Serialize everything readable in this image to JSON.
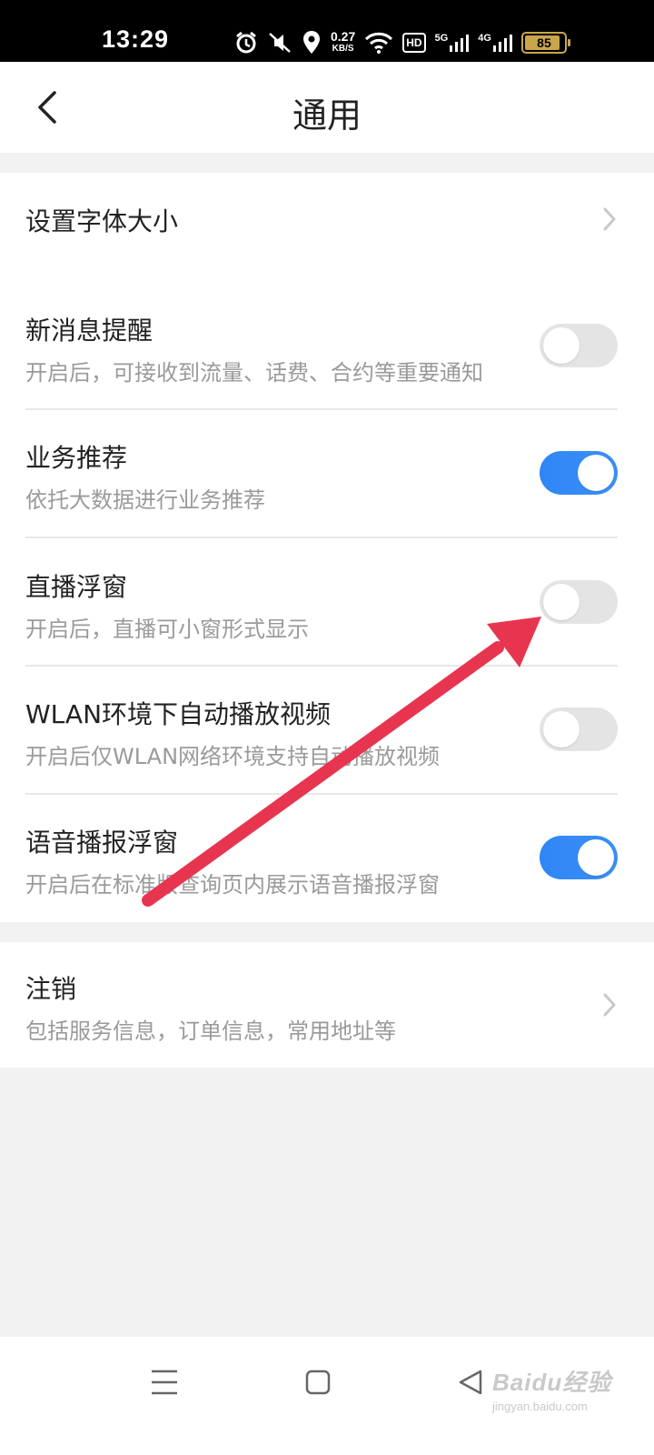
{
  "status_bar": {
    "time": "13:29",
    "net_speed_value": "0.27",
    "net_speed_unit": "KB/S",
    "hd_label": "HD",
    "net1_label": "5G",
    "net2_label": "4G",
    "battery": "85"
  },
  "header": {
    "title": "通用"
  },
  "settings": [
    {
      "title": "设置字体大小",
      "subtitle": "",
      "control": "chevron"
    },
    {
      "title": "新消息提醒",
      "subtitle": "开启后，可接收到流量、话费、合约等重要通知",
      "control": "toggle",
      "on": false
    },
    {
      "title": "业务推荐",
      "subtitle": "依托大数据进行业务推荐",
      "control": "toggle",
      "on": true
    },
    {
      "title": "直播浮窗",
      "subtitle": "开启后，直播可小窗形式显示",
      "control": "toggle",
      "on": false
    },
    {
      "title": "WLAN环境下自动播放视频",
      "subtitle": "开启后仅WLAN网络环境支持自动播放视频",
      "control": "toggle",
      "on": false
    },
    {
      "title": "语音播报浮窗",
      "subtitle": "开启后在标准版查询页内展示语音播报浮窗",
      "control": "toggle",
      "on": true
    }
  ],
  "logout": {
    "title": "注销",
    "subtitle": "包括服务信息，订单信息，常用地址等"
  },
  "colors": {
    "toggle_on": "#2f86f6",
    "toggle_off": "#e4e4e4",
    "annotation_arrow": "#e8354f"
  },
  "watermark": {
    "main": "Baidu经验",
    "sub": "jingyan.baidu.com"
  }
}
